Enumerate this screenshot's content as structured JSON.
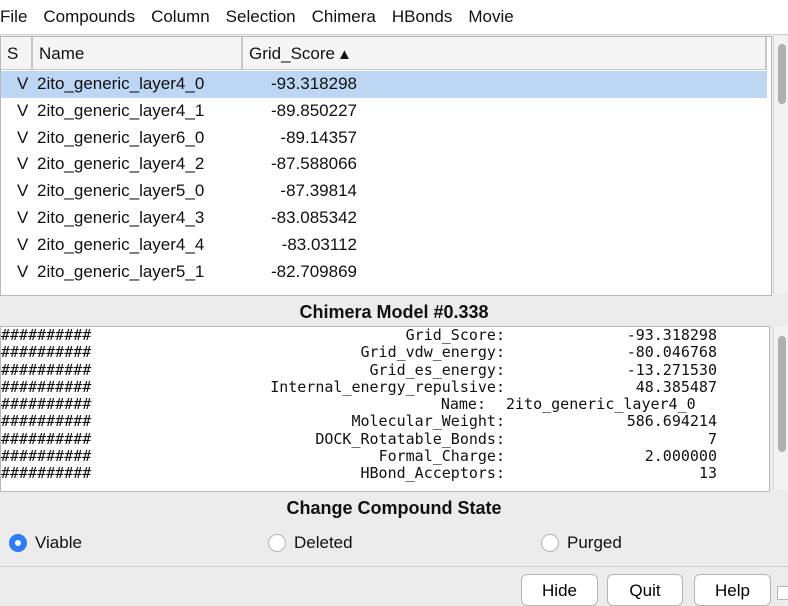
{
  "menubar": {
    "items": [
      "File",
      "Compounds",
      "Column",
      "Selection",
      "Chimera",
      "HBonds",
      "Movie"
    ]
  },
  "table": {
    "columns": {
      "s": "S",
      "name": "Name",
      "score": "Grid_Score",
      "sort_indicator": "▲"
    },
    "rows": [
      {
        "s": "V",
        "name": "2ito_generic_layer4_0",
        "score": "-93.318298",
        "selected": true
      },
      {
        "s": "V",
        "name": "2ito_generic_layer4_1",
        "score": "-89.850227",
        "selected": false
      },
      {
        "s": "V",
        "name": "2ito_generic_layer6_0",
        "score": "-89.14357",
        "selected": false
      },
      {
        "s": "V",
        "name": "2ito_generic_layer4_2",
        "score": "-87.588066",
        "selected": false
      },
      {
        "s": "V",
        "name": "2ito_generic_layer5_0",
        "score": "-87.39814",
        "selected": false
      },
      {
        "s": "V",
        "name": "2ito_generic_layer4_3",
        "score": "-83.085342",
        "selected": false
      },
      {
        "s": "V",
        "name": "2ito_generic_layer4_4",
        "score": "-83.03112",
        "selected": false
      },
      {
        "s": "V",
        "name": "2ito_generic_layer5_1",
        "score": "-82.709869",
        "selected": false
      }
    ]
  },
  "model_title": "Chimera Model #0.338",
  "info": {
    "rows": [
      {
        "hash": "##########",
        "key": "Grid_Score:",
        "value": "-93.318298"
      },
      {
        "hash": "##########",
        "key": "Grid_vdw_energy:",
        "value": "-80.046768"
      },
      {
        "hash": "##########",
        "key": "Grid_es_energy:",
        "value": "-13.271530"
      },
      {
        "hash": "##########",
        "key": "Internal_energy_repulsive:",
        "value": "48.385487"
      },
      {
        "hash": "##########",
        "key": "Name:",
        "value": "2ito_generic_layer4_0"
      },
      {
        "hash": "##########",
        "key": "Molecular_Weight:",
        "value": "586.694214"
      },
      {
        "hash": "##########",
        "key": "DOCK_Rotatable_Bonds:",
        "value": "7"
      },
      {
        "hash": "##########",
        "key": "Formal_Charge:",
        "value": "2.000000"
      },
      {
        "hash": "##########",
        "key": "HBond_Acceptors:",
        "value": "13"
      }
    ]
  },
  "state": {
    "title": "Change Compound State",
    "options": [
      {
        "label": "Viable",
        "checked": true
      },
      {
        "label": "Deleted",
        "checked": false
      },
      {
        "label": "Purged",
        "checked": false
      }
    ]
  },
  "buttons": {
    "hide": "Hide",
    "quit": "Quit",
    "help": "Help"
  },
  "colors": {
    "selection": "#bcd6f4",
    "radio_accent": "#2e7cf6"
  }
}
